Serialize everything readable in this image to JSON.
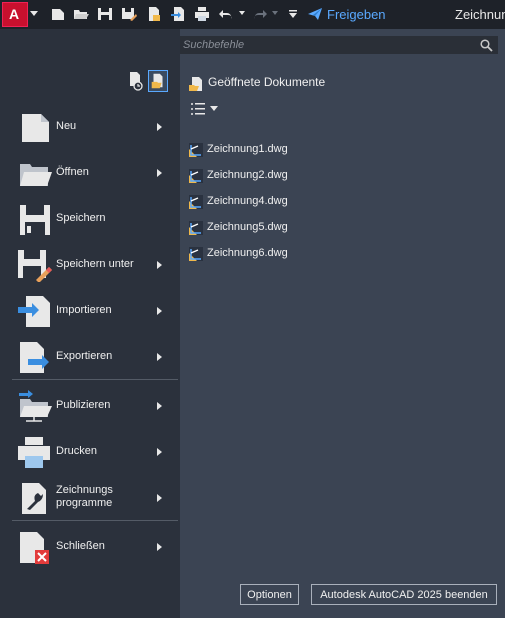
{
  "quick_access": {
    "app_letter": "A",
    "share_label": "Freigeben",
    "title": "Zeichnung"
  },
  "search": {
    "placeholder": "Suchbefehle"
  },
  "menu": [
    {
      "label": "Neu",
      "icon": "new-document-icon"
    },
    {
      "label": "Öffnen",
      "icon": "folder-open-icon"
    },
    {
      "label": "Speichern",
      "icon": "save-icon"
    },
    {
      "label": "Speichern unter",
      "icon": "save-as-icon"
    },
    {
      "label": "Importieren",
      "icon": "import-icon"
    },
    {
      "label": "Exportieren",
      "icon": "export-icon"
    },
    {
      "label": "Publizieren",
      "icon": "publish-icon"
    },
    {
      "label": "Drucken",
      "icon": "print-icon"
    },
    {
      "label": "Zeichnungs programme",
      "icon": "drawing-utilities-icon"
    },
    {
      "label": "Schließen",
      "icon": "close-document-icon"
    }
  ],
  "open_documents": {
    "title": "Geöffnete Dokumente",
    "files": [
      "Zeichnung1.dwg",
      "Zeichnung2.dwg",
      "Zeichnung4.dwg",
      "Zeichnung5.dwg",
      "Zeichnung6.dwg"
    ]
  },
  "footer": {
    "options_label": "Optionen",
    "exit_label": "Autodesk AutoCAD 2025 beenden"
  },
  "colors": {
    "accent": "#5aa9ff",
    "app_red": "#c8102e",
    "panel_left": "#2b313c",
    "panel_right": "#3b4453"
  }
}
